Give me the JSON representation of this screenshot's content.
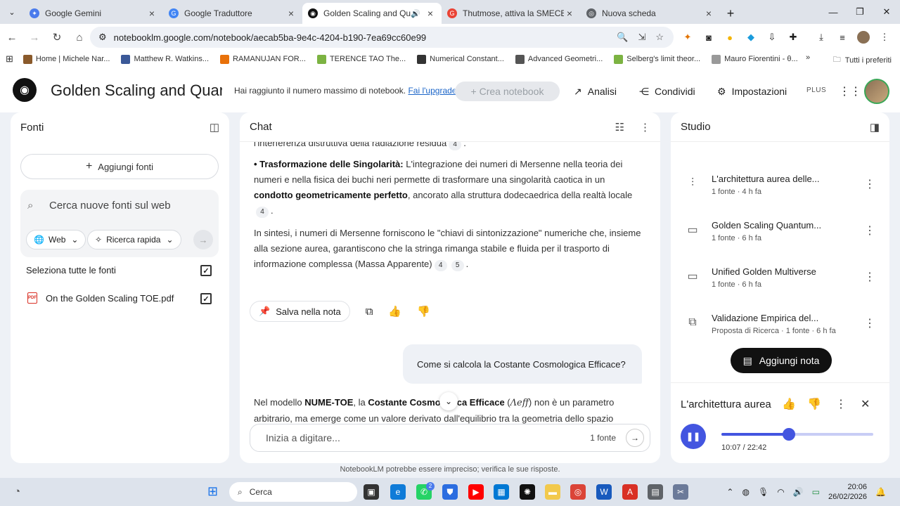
{
  "browser": {
    "tabs": [
      {
        "title": "Google Gemini",
        "color": "#4b7bec",
        "glyph": "✦",
        "active": false
      },
      {
        "title": "Google Traduttore",
        "color": "#4285f4",
        "glyph": "G",
        "active": false
      },
      {
        "title": "Golden Scaling and Quantu",
        "color": "#111111",
        "glyph": "◉",
        "active": true
      },
      {
        "title": "Thutmose, attiva la SMECE con",
        "color": "#ea4335",
        "glyph": "G",
        "active": false
      },
      {
        "title": "Nuova scheda",
        "color": "#5f6368",
        "glyph": "◎",
        "active": false
      }
    ],
    "url": "notebooklm.google.com/notebook/aecab5ba-9e4c-4204-b190-7ea69cc60e99",
    "bookmarks": [
      {
        "label": "Home | Michele Nar...",
        "color": "#8a5a2b"
      },
      {
        "label": "Matthew R. Watkins...",
        "color": "#3b5998"
      },
      {
        "label": "RAMANUJAN FOR...",
        "color": "#e8710a"
      },
      {
        "label": "TERENCE TAO  The...",
        "color": "#7cb342"
      },
      {
        "label": "Numerical Constant...",
        "color": "#333333"
      },
      {
        "label": "Advanced Geometri...",
        "color": "#555555"
      },
      {
        "label": "Selberg's limit theor...",
        "color": "#7cb342"
      },
      {
        "label": "Mauro Fiorentini - θ...",
        "color": "#999999"
      }
    ],
    "bookmarks_all": "Tutti i preferiti"
  },
  "header": {
    "title": "Golden Scaling and Quantum",
    "limit_text": "Hai raggiunto il numero massimo di notebook.",
    "upgrade_link": "Fai l'upgrade",
    "create_label": "+ Crea notebook",
    "analisi": "Analisi",
    "condividi": "Condividi",
    "impostazioni": "Impostazioni",
    "plan": "PLUS"
  },
  "sources": {
    "title": "Fonti",
    "add_label": "Aggiungi fonti",
    "search_placeholder": "Cerca nuove fonti sul web",
    "chip_web": "Web",
    "chip_research": "Ricerca rapida",
    "select_all": "Seleziona tutte le fonti",
    "items": [
      {
        "name": "On the Golden Scaling TOE.pdf",
        "checked": true
      }
    ]
  },
  "chat": {
    "title": "Chat",
    "p0_text": "l'interferenza distruttiva della radiazione residua",
    "p0_ref": "4",
    "p1_lead": "• Trasformazione delle Singolarità:",
    "p1_a": " L'integrazione dei numeri di Mersenne nella teoria dei numeri e nella fisica dei buchi neri permette di trasformare una singolarità caotica in un ",
    "p1_bold": "condotto geometricamente perfetto",
    "p1_b": ", ancorato alla struttura dodecaedrica della realtà locale",
    "p1_ref": "4",
    "p2_text": "In sintesi, i numeri di Mersenne forniscono le \"chiavi di sintonizzazione\" numeriche che, insieme alla sezione aurea, garantiscono che la stringa rimanga stabile e fluida per il trasporto di informazione complessa (Massa Apparente)",
    "p2_ref1": "4",
    "p2_ref2": "5",
    "save_note": "Salva nella nota",
    "user_question": "Come si calcola la Costante Cosmologica Efficace?",
    "ans_a": "Nel modello ",
    "ans_b1": "NUME-TOE",
    "ans_c": ", la ",
    "ans_b2": "Costante Cosmologica Efficace",
    "ans_d": " (",
    "ans_math": "Λeff",
    "ans_e": ") non è un parametro arbitrario, ma emerge come un valore derivato dall'equilibrio tra la geometria dello spazio",
    "composer_placeholder": "Inizia a digitare...",
    "source_count": "1 fonte"
  },
  "studio": {
    "title": "Studio",
    "items": [
      {
        "icon": "audio-icon",
        "glyph": "⫶",
        "title": "L'architettura aurea delle...",
        "meta": "1 fonte · 4 h fa"
      },
      {
        "icon": "slides-icon",
        "glyph": "▭",
        "title": "Golden Scaling Quantum...",
        "meta": "1 fonte · 6 h fa"
      },
      {
        "icon": "slides-icon",
        "glyph": "▭",
        "title": "Unified Golden Multiverse",
        "meta": "1 fonte · 6 h fa"
      },
      {
        "icon": "report-icon",
        "glyph": "⧉",
        "title": "Validazione Empirica del...",
        "meta": "Proposta di Ricerca · 1 fonte · 6 h fa"
      }
    ],
    "add_note": "Aggiungi nota",
    "player": {
      "title": "L'architettura aurea delle...",
      "elapsed": "10:07",
      "total": "22:42",
      "progress": 0.445
    }
  },
  "disclaimer": "NotebookLM potrebbe essere impreciso; verifica le sue risposte.",
  "taskbar": {
    "search": "Cerca",
    "time": "20:06",
    "date": "26/02/2026",
    "whatsapp_badge": "2"
  }
}
